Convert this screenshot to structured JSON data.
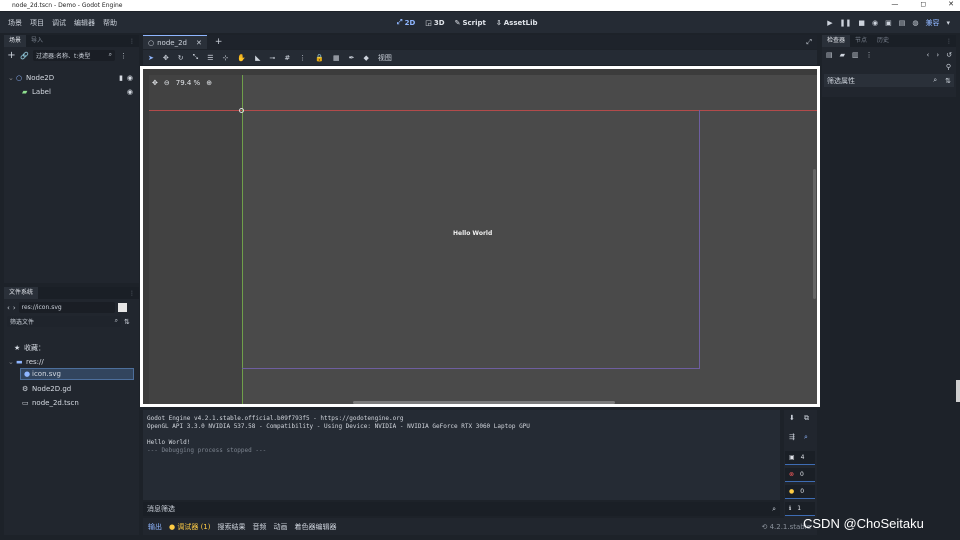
{
  "window": {
    "title": "node_2d.tscn - Demo - Godot Engine",
    "controls": [
      "—",
      "◻",
      "✕"
    ]
  },
  "menu": [
    "场景",
    "项目",
    "调试",
    "编辑器",
    "帮助"
  ],
  "workspaces": [
    {
      "label": "2D",
      "icon": "2d-icon"
    },
    {
      "label": "3D",
      "icon": "3d-icon"
    },
    {
      "label": "Script",
      "icon": "script-icon"
    },
    {
      "label": "AssetLib",
      "icon": "assetlib-icon"
    }
  ],
  "renderer": "兼容",
  "scene_dock": {
    "tabs": [
      "场景",
      "导入"
    ],
    "filter_placeholder": "过滤器:名称、t:类型",
    "nodes": [
      {
        "name": "Node2D"
      },
      {
        "name": "Label"
      }
    ]
  },
  "filesystem_dock": {
    "tab": "文件系统",
    "path": "res://icon.svg",
    "filter_placeholder": "筛选文件",
    "favorites": "收藏：",
    "root": "res://",
    "files": [
      "icon.svg",
      "Node2D.gd",
      "node_2d.tscn"
    ]
  },
  "editor": {
    "tab": "node_2d",
    "add_tab": "+",
    "view_menu": "视图",
    "zoom": "79.4 %",
    "label_text": "Hello World"
  },
  "console": {
    "lines": [
      "Godot Engine v4.2.1.stable.official.b09f793f5 - https://godotengine.org",
      "OpenGL API 3.3.0 NVIDIA 537.58 - Compatibility - Using Device: NVIDIA - NVIDIA GeForce RTX 3060 Laptop GPU",
      "",
      "Hello World!",
      "--- Debugging process stopped ---"
    ],
    "filter_placeholder": "消息筛选",
    "counts": [
      "4",
      "0",
      "0",
      "1"
    ]
  },
  "bottom_panel": {
    "tabs": [
      "输出",
      "调试器 (1)",
      "搜索结果",
      "音频",
      "动画",
      "着色器编辑器"
    ],
    "version": "4.2.1.stable"
  },
  "inspector": {
    "tabs": [
      "检查器",
      "节点",
      "历史"
    ],
    "filter_placeholder": "筛选属性"
  },
  "watermark": "CSDN @ChoSeitaku"
}
